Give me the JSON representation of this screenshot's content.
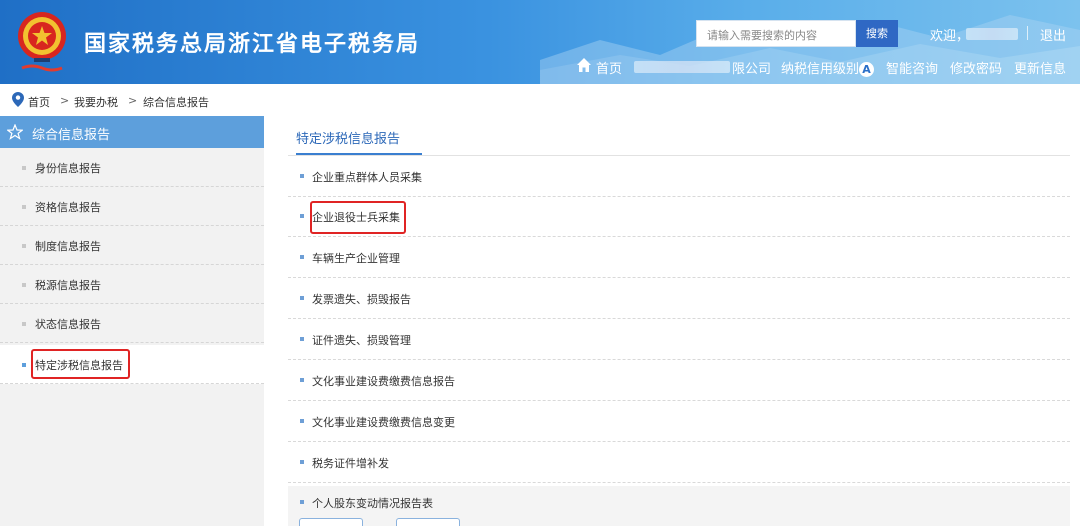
{
  "header": {
    "site_title": "国家税务总局浙江省电子税务局",
    "search_placeholder": "请输入需要搜索的内容",
    "search_button": "搜索",
    "welcome_label": "欢迎，",
    "logout": "退出",
    "home_label": "首页",
    "company_suffix": "限公司",
    "credit_rating_label": "纳税信用级别",
    "credit_rating_value": "A",
    "smart_consult": "智能咨询",
    "change_password": "修改密码",
    "update_info": "更新信息",
    "colors": {
      "header_blue": "#2a78cf",
      "search_button": "#2f68c4"
    }
  },
  "breadcrumb": {
    "items": [
      "首页",
      "我要办税",
      "综合信息报告"
    ],
    "separator": ">"
  },
  "sidebar": {
    "header": "综合信息报告",
    "items": [
      {
        "label": "身份信息报告",
        "active": false
      },
      {
        "label": "资格信息报告",
        "active": false
      },
      {
        "label": "制度信息报告",
        "active": false
      },
      {
        "label": "税源信息报告",
        "active": false
      },
      {
        "label": "状态信息报告",
        "active": false
      },
      {
        "label": "特定涉税信息报告",
        "active": true,
        "highlighted": true
      }
    ]
  },
  "main": {
    "tab": "特定涉税信息报告",
    "items": [
      {
        "label": "企业重点群体人员采集",
        "highlighted": false
      },
      {
        "label": "企业退役士兵采集",
        "highlighted": true
      },
      {
        "label": "车辆生产企业管理",
        "highlighted": false
      },
      {
        "label": "发票遗失、损毁报告",
        "highlighted": false
      },
      {
        "label": "证件遗失、损毁管理",
        "highlighted": false
      },
      {
        "label": "文化事业建设费缴费信息报告",
        "highlighted": false
      },
      {
        "label": "文化事业建设费缴费信息变更",
        "highlighted": false
      },
      {
        "label": "税务证件增补发",
        "highlighted": false
      },
      {
        "label": "个人股东变动情况报告表",
        "highlighted": false
      }
    ]
  },
  "icons": [
    "national-emblem-icon",
    "home-icon",
    "location-pin-icon",
    "star-icon"
  ],
  "highlight_color": "#e02424"
}
